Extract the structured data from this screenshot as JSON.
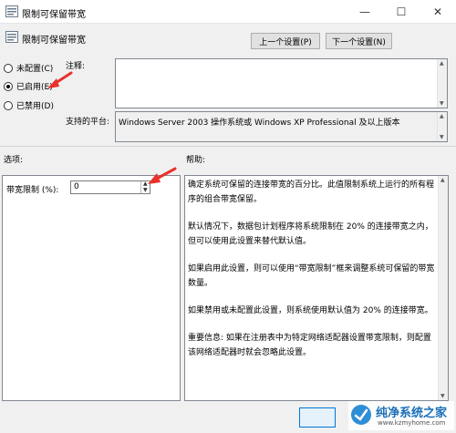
{
  "window": {
    "title": "限制可保留带宽",
    "controls": {
      "minimize": "—",
      "maximize": "☐",
      "close": "✕"
    }
  },
  "header": {
    "title": "限制可保留带宽",
    "prev_button": "上一个设置(P)",
    "next_button": "下一个设置(N)"
  },
  "state": {
    "options": [
      {
        "label": "未配置(C)",
        "checked": false
      },
      {
        "label": "已启用(E)",
        "checked": true
      },
      {
        "label": "已禁用(D)",
        "checked": false
      }
    ]
  },
  "comment": {
    "label": "注释:",
    "value": ""
  },
  "platform": {
    "label": "支持的平台:",
    "value": "Windows Server 2003 操作系统或 Windows XP Professional 及以上版本"
  },
  "options_section": {
    "label": "选项:",
    "bandwidth_label": "带宽限制 (%):",
    "bandwidth_value": "0"
  },
  "help": {
    "label": "帮助:",
    "paragraphs": [
      "确定系统可保留的连接带宽的百分比。此值限制系统上运行的所有程序的组合带宽保留。",
      "默认情况下，数据包计划程序将系统限制在 20% 的连接带宽之内，但可以使用此设置来替代默认值。",
      "如果启用此设置，则可以使用“带宽限制”框来调整系统可保留的带宽数量。",
      "如果禁用或未配置此设置，则系统使用默认值为 20% 的连接带宽。",
      "重要信息: 如果在注册表中为特定网络适配器设置带宽限制，则配置该网络适配器时就会忽略此设置。"
    ]
  },
  "watermark": {
    "name": "纯净系统之家",
    "url": "www.kzmyhome.com"
  },
  "colors": {
    "annotation_arrow": "#e8322b",
    "selection": "#0078d7"
  }
}
